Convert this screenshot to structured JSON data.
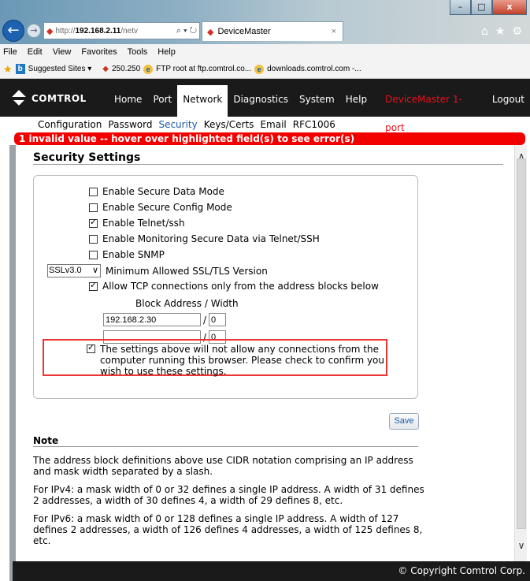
{
  "browser": {
    "window_buttons": {
      "minimize": "–",
      "maximize": "□",
      "close": "x"
    },
    "address": {
      "prefix": "http://",
      "host": "192.168.2.11",
      "rest": "/netv"
    },
    "tab_title": "DeviceMaster",
    "tab_close": "×",
    "menu": [
      "File",
      "Edit",
      "View",
      "Favorites",
      "Tools",
      "Help"
    ],
    "favorites": {
      "suggested": "Suggested Sites ▾",
      "item1": "250.250",
      "item2": "FTP root at ftp.comtrol.co...",
      "item3": "downloads.comtrol.com -..."
    }
  },
  "header": {
    "logo": "COMTROL",
    "nav": [
      "Home",
      "Port",
      "Network",
      "Diagnostics",
      "System",
      "Help"
    ],
    "active_nav": "Network",
    "device_name": "DeviceMaster 1-port",
    "logout": "Logout"
  },
  "subnav": {
    "items": [
      "Configuration",
      "Password",
      "Security",
      "Keys/Certs",
      "Email",
      "RFC1006"
    ],
    "active": "Security"
  },
  "error_banner": "1 invalid value -- hover over highlighted field(s) to see error(s)",
  "security": {
    "title": "Security Settings",
    "options": [
      {
        "label": "Enable Secure Data Mode",
        "checked": false
      },
      {
        "label": "Enable Secure Config Mode",
        "checked": false
      },
      {
        "label": "Enable Telnet/ssh",
        "checked": true
      },
      {
        "label": "Enable Monitoring Secure Data via Telnet/SSH",
        "checked": false
      },
      {
        "label": "Enable SNMP",
        "checked": false
      }
    ],
    "ssl": {
      "value": "SSLv3.0",
      "label": "Minimum Allowed SSL/TLS Version"
    },
    "allow_tcp": {
      "label": "Allow TCP connections only from the address blocks below",
      "checked": true
    },
    "block_header": "Block Address / Width",
    "blocks": [
      {
        "address": "192.168.2.30",
        "width": "0"
      },
      {
        "address": "",
        "width": "0"
      }
    ],
    "confirm": {
      "checked": true,
      "text": "The settings above will not allow any connections from the computer running this browser. Please check to confirm you wish to use these settings."
    },
    "save": "Save"
  },
  "note": {
    "title": "Note",
    "paragraphs": [
      "The address block definitions above use CIDR notation comprising an IP address and mask width separated by a slash.",
      "For IPv4: a mask width of 0 or 32 defines a single IP address. A width of 31 defines 2 addresses, a width of 30 defines 4, a width of 29 defines 8, etc.",
      "For IPv6: a mask width of 0 or 128 defines a single IP address. A width of 127 defines 2 addresses, a width of 126 defines 4 addresses, a width of 125 defines 8, etc."
    ]
  },
  "footer": "© Copyright Comtrol Corp."
}
